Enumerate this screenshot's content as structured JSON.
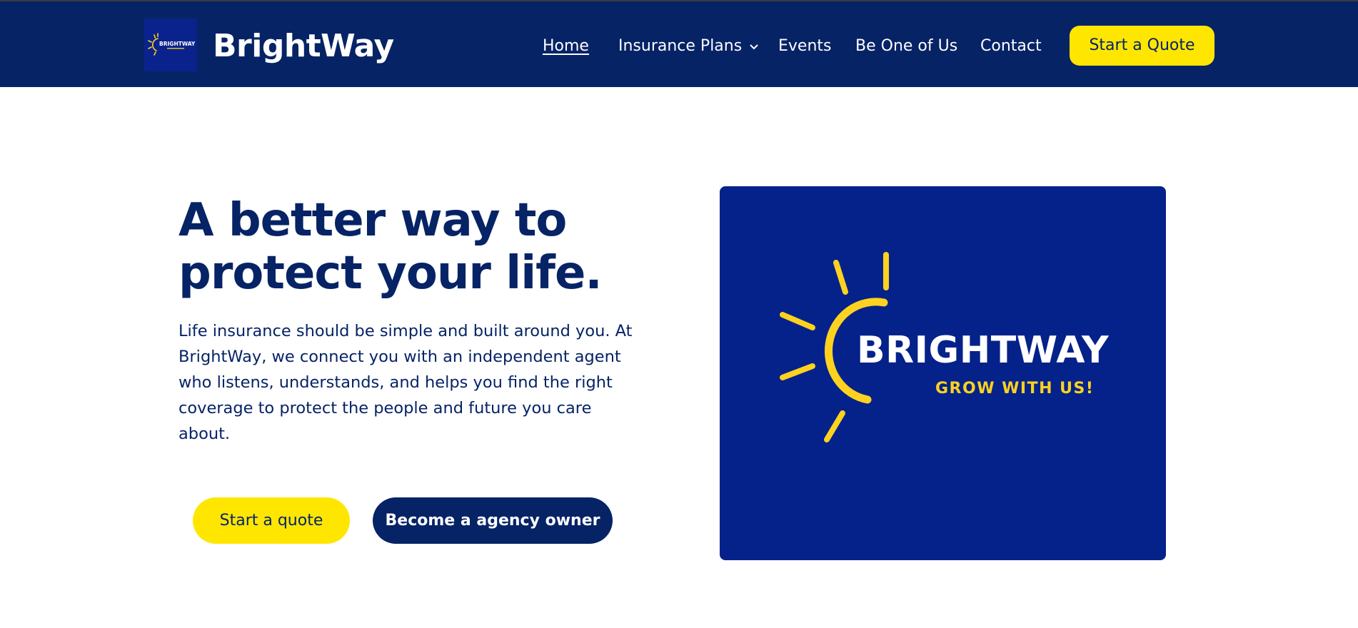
{
  "header": {
    "brand": "BrightWay",
    "logo_icon": "brightway-sun-logo",
    "logo_text": "BRIGHTWAY",
    "nav": [
      {
        "label": "Home",
        "active": true
      },
      {
        "label": "Insurance Plans",
        "has_dropdown": true
      },
      {
        "label": "Events"
      },
      {
        "label": "Be One of Us"
      },
      {
        "label": "Contact"
      }
    ],
    "cta_label": "Start a Quote"
  },
  "hero": {
    "title": "A better way to protect your life.",
    "body": "Life insurance should be simple and built around you. At BrightWay, we connect you with an independent agent who listens, understands, and helps you find the right coverage to protect the people and future you care about.",
    "primary_button": "Start a quote",
    "secondary_button": "Become a agency owner",
    "image": {
      "wordmark": "BRIGHTWAY",
      "tagline": "GROW WITH US!",
      "icon": "sun-icon"
    }
  },
  "colors": {
    "navy": "#062366",
    "yellow": "#ffe600",
    "image_blue": "#04228a",
    "sun_yellow": "#ffd21f"
  }
}
